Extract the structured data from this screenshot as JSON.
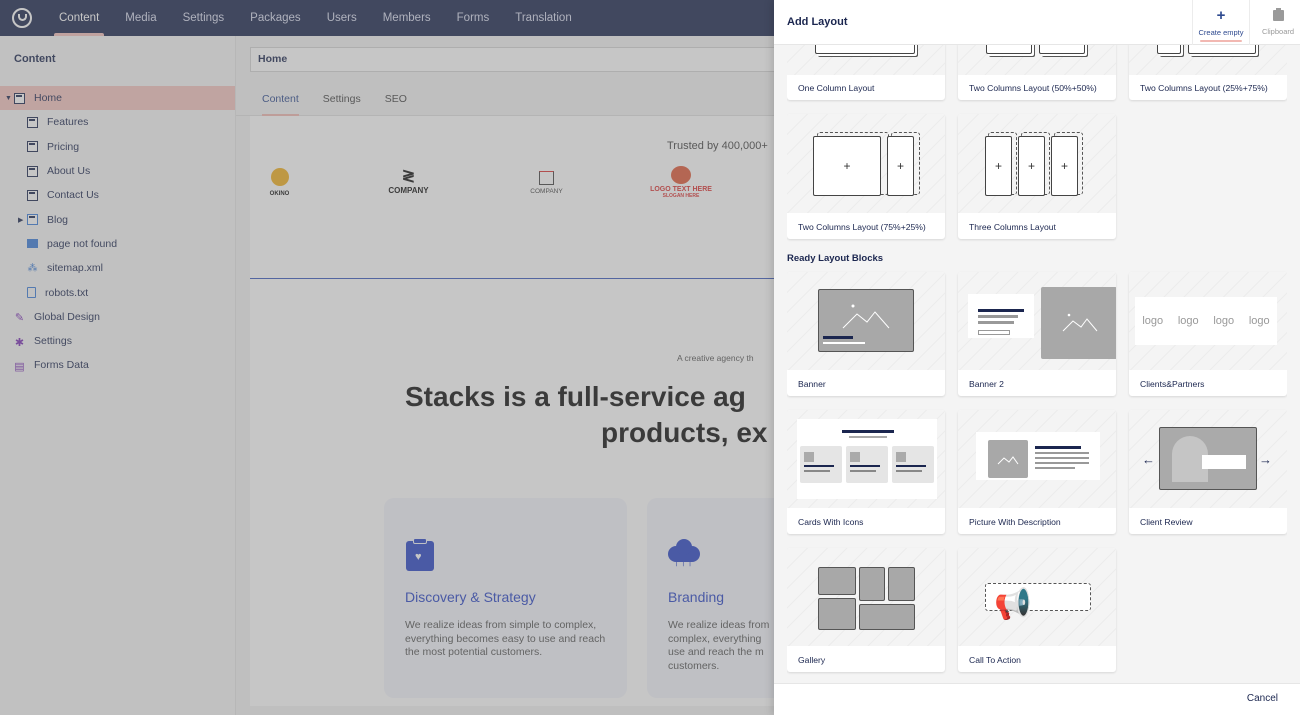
{
  "nav": {
    "items": [
      "Content",
      "Media",
      "Settings",
      "Packages",
      "Users",
      "Members",
      "Forms",
      "Translation"
    ],
    "active": "Content"
  },
  "sidebar": {
    "title": "Content",
    "tree": [
      {
        "label": "Home",
        "icon": "home-page-icon",
        "level": 0,
        "expand": true,
        "selected": true
      },
      {
        "label": "Features",
        "icon": "document-icon",
        "level": 1
      },
      {
        "label": "Pricing",
        "icon": "document-icon",
        "level": 1
      },
      {
        "label": "About Us",
        "icon": "document-icon",
        "level": 1
      },
      {
        "label": "Contact Us",
        "icon": "document-icon",
        "level": 1
      },
      {
        "label": "Blog",
        "icon": "blog-icon",
        "level": 1,
        "expand": true
      },
      {
        "label": "page not found",
        "icon": "browser-icon",
        "level": 1
      },
      {
        "label": "sitemap.xml",
        "icon": "sitemap-icon",
        "level": 1
      },
      {
        "label": "robots.txt",
        "icon": "file-icon",
        "level": 1
      },
      {
        "label": "Global Design",
        "icon": "paint-icon",
        "level": 0
      },
      {
        "label": "Settings",
        "icon": "gear-icon",
        "level": 0
      },
      {
        "label": "Forms Data",
        "icon": "inbox-icon",
        "level": 0
      }
    ]
  },
  "editor": {
    "node_name": "Home",
    "tabs": [
      "Content",
      "Settings",
      "SEO"
    ],
    "active_tab": "Content"
  },
  "preview": {
    "trusted": "Trusted by 400,000+",
    "brands": [
      "OKINO",
      "COMPANY",
      "COMPANY",
      "LOGO TEXT HERE",
      "SLOGAN HERE"
    ],
    "tagline": "A creative agency th",
    "headline_1": "Stacks is a full-service ag",
    "headline_2": "products, ex",
    "cards": [
      {
        "title": "Discovery & Strategy",
        "text": "We realize ideas from simple to complex, everything becomes easy to use and reach the most potential customers."
      },
      {
        "title": "Branding",
        "text": "We realize ideas from complex, everything use and reach the m customers."
      }
    ]
  },
  "panel": {
    "title": "Add Layout",
    "create_empty": "Create empty",
    "clipboard": "Clipboard",
    "section_ready": "Ready Layout Blocks",
    "layouts": [
      "One Column Layout",
      "Two Columns Layout (50%+50%)",
      "Two Columns Layout (25%+75%)",
      "Two Columns Layout (75%+25%)",
      "Three Columns Layout"
    ],
    "blocks": [
      "Banner",
      "Banner 2",
      "Clients&Partners",
      "Cards With Icons",
      "Picture With Description",
      "Client Review",
      "Gallery",
      "Call To Action"
    ],
    "logo_word": "logo",
    "plus": "+",
    "cancel": "Cancel"
  },
  "colors": {
    "nav_bg": "#1b264f",
    "selected_row": "#f5c4c0",
    "accent_blue": "#2a45c7"
  }
}
